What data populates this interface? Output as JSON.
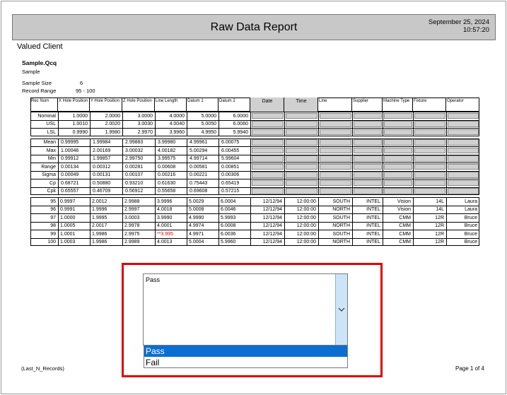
{
  "report": {
    "title": "Raw Data Report",
    "date": "September 25, 2024",
    "time": "10:57:20",
    "client": "Valued Client",
    "sample_file": "Sample.Qcq",
    "sample_desc": "Sample",
    "sample_size_label": "Sample Size",
    "sample_size": "6",
    "record_range_label": "Record Range",
    "record_range": "95 - 100"
  },
  "headers": [
    "Rec Num",
    "X Hole Position",
    "Y Hole Position",
    "Z Hole Position",
    "Line Length",
    "Datum 1",
    "Datum 2",
    "Date",
    "Time",
    "Line",
    "Supplier",
    "Machine Type",
    "Fixture",
    "Operator"
  ],
  "spec_rows": [
    {
      "label": "Nominal",
      "values": [
        "1.0000",
        "2.0000",
        "3.0000",
        "4.0000",
        "5.0000",
        "6.0000"
      ]
    },
    {
      "label": "USL",
      "values": [
        "1.0010",
        "2.0020",
        "3.0030",
        "4.0040",
        "5.0050",
        "6.0060"
      ]
    },
    {
      "label": "LSL",
      "values": [
        "0.9990",
        "1.9980",
        "2.9970",
        "3.9960",
        "4.9950",
        "5.9940"
      ]
    }
  ],
  "stat_rows": [
    {
      "label": "Mean",
      "values": [
        "0.99995",
        "1.99984",
        "2.99883",
        "3.99980",
        "4.99961",
        "6.00075"
      ]
    },
    {
      "label": "Max",
      "values": [
        "1.00046",
        "2.00169",
        "3.00032",
        "4.00182",
        "5.00294",
        "6.00455"
      ]
    },
    {
      "label": "Min",
      "values": [
        "0.99912",
        "1.99857",
        "2.99750",
        "3.99575",
        "4.99714",
        "5.99604"
      ]
    },
    {
      "label": "Range",
      "values": [
        "0.00134",
        "0.00312",
        "0.00281",
        "0.00608",
        "0.00581",
        "0.00851"
      ]
    },
    {
      "label": "Sigma",
      "values": [
        "0.00049",
        "0.00131",
        "0.00107",
        "0.00216",
        "0.00221",
        "0.00306"
      ]
    },
    {
      "label": "Cp",
      "values": [
        "0.68721",
        "0.50880",
        "0.93210",
        "0.61630",
        "0.75443",
        "0.65419"
      ]
    },
    {
      "label": "Cpk",
      "values": [
        "0.65557",
        "0.46709",
        "0.56912",
        "0.55658",
        "0.69608",
        "0.57215"
      ]
    }
  ],
  "data_rows": [
    {
      "rec": "95",
      "values": [
        "0.9997",
        "2.0012",
        "2.9988",
        "3.9996",
        "5.0029",
        "6.0004"
      ],
      "date": "12/12/94",
      "time": "12:00:00",
      "line": "SOUTH",
      "supplier": "INTEL",
      "machine": "Vision",
      "fixture": "14L",
      "operator": "Laura"
    },
    {
      "rec": "96",
      "values": [
        "0.9991",
        "1.9996",
        "2.9997",
        "4.0018",
        "5.0008",
        "6.0046"
      ],
      "date": "12/12/94",
      "time": "12:00:00",
      "line": "NORTH",
      "supplier": "INTEL",
      "machine": "Vision",
      "fixture": "14L",
      "operator": "Laura"
    },
    {
      "rec": "97",
      "values": [
        "1.0000",
        "1.9995",
        "3.0003",
        "3.9990",
        "4.9990",
        "5.9993"
      ],
      "date": "12/12/94",
      "time": "12:00:00",
      "line": "SOUTH",
      "supplier": "INTEL",
      "machine": "CMM",
      "fixture": "12R",
      "operator": "Bruce"
    },
    {
      "rec": "98",
      "values": [
        "1.0005",
        "2.0017",
        "2.9978",
        "4.0001",
        "4.9974",
        "6.0008"
      ],
      "date": "12/12/94",
      "time": "12:00:00",
      "line": "NORTH",
      "supplier": "INTEL",
      "machine": "CMM",
      "fixture": "12R",
      "operator": "Bruce"
    },
    {
      "rec": "99",
      "values": [
        "1.0001",
        "1.9986",
        "2.9975",
        "**3.995",
        "4.9971",
        "6.0036"
      ],
      "date": "12/12/94",
      "time": "12:00:00",
      "line": "SOUTH",
      "supplier": "INTEL",
      "machine": "CMM",
      "fixture": "12R",
      "operator": "Bruce"
    },
    {
      "rec": "100",
      "values": [
        "1.0003",
        "1.9986",
        "2.9989",
        "4.0013",
        "5.0004",
        "5.9960"
      ],
      "date": "12/12/94",
      "time": "12:00:00",
      "line": "NORTH",
      "supplier": "INTEL",
      "machine": "CMM",
      "fixture": "12R",
      "operator": "Bruce"
    }
  ],
  "out_of_spec_color": "#e00000",
  "dropdown": {
    "value": "Pass",
    "options": [
      "Pass",
      "Fail"
    ],
    "selected_option": "Pass",
    "icon": "chevron-down-icon"
  },
  "footer": {
    "left": "(Last_N_Records)",
    "page": "Page 1 of 4"
  },
  "colors": {
    "highlight_border": "#e00000",
    "selected_option_bg": "#0b6fd1",
    "header_gray": "#d0d0d0"
  }
}
